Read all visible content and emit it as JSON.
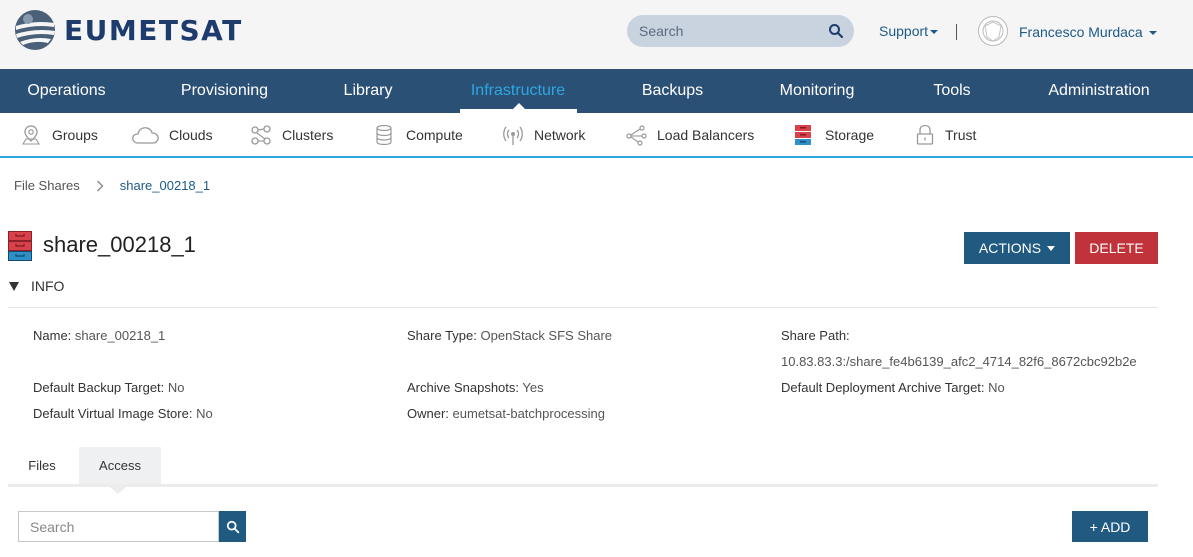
{
  "brand": {
    "name": "EUMETSAT",
    "logo_icon": "globe-icon"
  },
  "header": {
    "search_placeholder": "Search",
    "support_label": "Support",
    "user_name": "Francesco Murdaca"
  },
  "main_nav": [
    {
      "label": "Operations"
    },
    {
      "label": "Provisioning"
    },
    {
      "label": "Library"
    },
    {
      "label": "Infrastructure",
      "active": true
    },
    {
      "label": "Backups"
    },
    {
      "label": "Monitoring"
    },
    {
      "label": "Tools"
    },
    {
      "label": "Administration"
    }
  ],
  "sub_nav": [
    {
      "label": "Groups",
      "icon": "map-pin-icon"
    },
    {
      "label": "Clouds",
      "icon": "cloud-icon"
    },
    {
      "label": "Clusters",
      "icon": "clusters-icon"
    },
    {
      "label": "Compute",
      "icon": "database-icon"
    },
    {
      "label": "Network",
      "icon": "wireless-icon"
    },
    {
      "label": "Load Balancers",
      "icon": "load-balancer-icon"
    },
    {
      "label": "Storage",
      "icon": "storage-icon",
      "active": true
    },
    {
      "label": "Trust",
      "icon": "lock-icon"
    }
  ],
  "breadcrumb": {
    "root": "File Shares",
    "current": "share_00218_1"
  },
  "page": {
    "title": "share_00218_1",
    "actions_label": "ACTIONS",
    "delete_label": "DELETE",
    "info_label": "INFO"
  },
  "info": {
    "name_label": "Name:",
    "name_value": "share_00218_1",
    "share_type_label": "Share Type:",
    "share_type_value": "OpenStack SFS Share",
    "share_path_label": "Share Path:",
    "share_path_value": "10.83.83.3:/share_fe4b6139_afc2_4714_82f6_8672cbc92b2e",
    "default_backup_label": "Default Backup Target:",
    "default_backup_value": "No",
    "archive_snapshots_label": "Archive Snapshots:",
    "archive_snapshots_value": "Yes",
    "default_deploy_label": "Default Deployment Archive Target:",
    "default_deploy_value": "No",
    "default_vis_label": "Default Virtual Image Store:",
    "default_vis_value": "No",
    "owner_label": "Owner:",
    "owner_value": "eumetsat-batchprocessing"
  },
  "tabs": [
    {
      "label": "Files"
    },
    {
      "label": "Access",
      "active": true
    }
  ],
  "access": {
    "search_placeholder": "Search",
    "add_label": "+ ADD"
  },
  "colors": {
    "nav_bg": "#2b5076",
    "accent": "#2ea7e0",
    "primary_button": "#205a80",
    "danger_button": "#c0333a"
  }
}
